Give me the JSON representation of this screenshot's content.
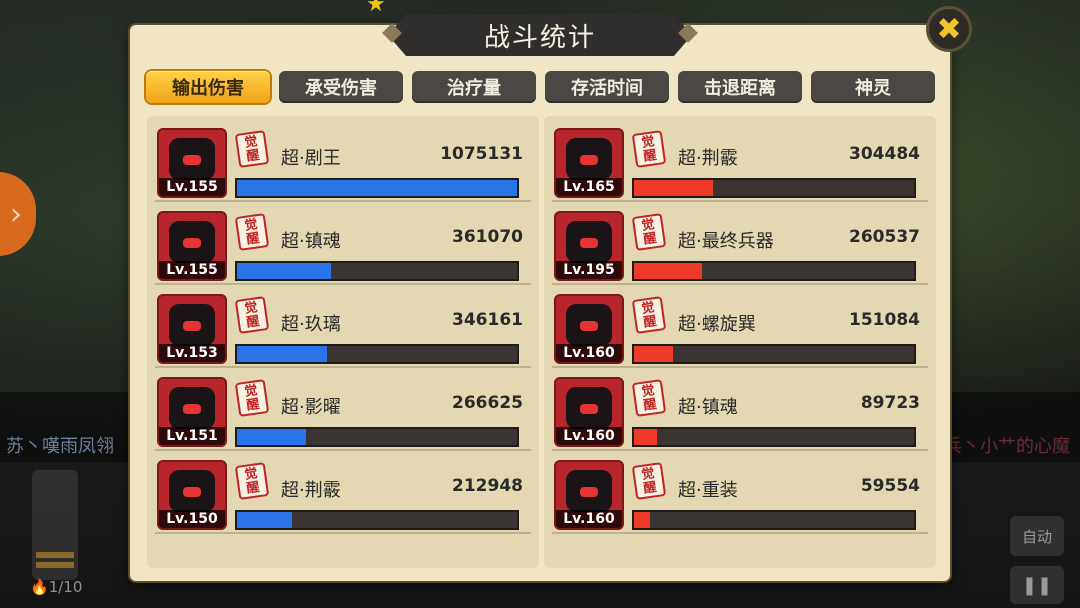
{
  "title": "战斗统计",
  "close_icon": "close-icon",
  "tabs": [
    {
      "label": "输出伤害",
      "active": true
    },
    {
      "label": "承受伤害",
      "active": false
    },
    {
      "label": "治疗量",
      "active": false
    },
    {
      "label": "存活时间",
      "active": false
    },
    {
      "label": "击退距离",
      "active": false
    },
    {
      "label": "神灵",
      "active": false
    }
  ],
  "awaken_badge": "觉醒",
  "left_team": [
    {
      "name": "超·剧王",
      "level": "Lv.155",
      "value": "1075131",
      "value_num": 1075131
    },
    {
      "name": "超·镇魂",
      "level": "Lv.155",
      "value": "361070",
      "value_num": 361070
    },
    {
      "name": "超·玖璃",
      "level": "Lv.153",
      "value": "346161",
      "value_num": 346161
    },
    {
      "name": "超·影曜",
      "level": "Lv.151",
      "value": "266625",
      "value_num": 266625
    },
    {
      "name": "超·荆霰",
      "level": "Lv.150",
      "value": "212948",
      "value_num": 212948
    }
  ],
  "right_team": [
    {
      "name": "超·荆霰",
      "level": "Lv.165",
      "value": "304484",
      "value_num": 304484
    },
    {
      "name": "超·最终兵器",
      "level": "Lv.195",
      "value": "260537",
      "value_num": 260537
    },
    {
      "name": "超·螺旋巽",
      "level": "Lv.160",
      "value": "151084",
      "value_num": 151084
    },
    {
      "name": "超·镇魂",
      "level": "Lv.160",
      "value": "89723",
      "value_num": 89723
    },
    {
      "name": "超·重装",
      "level": "Lv.160",
      "value": "59554",
      "value_num": 59554
    }
  ],
  "bar_max": 1075131,
  "colors": {
    "left_bar": "#2a73e8",
    "right_bar": "#ee3a28",
    "active_tab": "#f0a318"
  },
  "background": {
    "left_player": "苏丶嘆雨凤翎",
    "right_player": "兵丶小艹的心魔",
    "energy": "1/10",
    "auto_label": "自动",
    "pause_icon": "pause-icon"
  }
}
